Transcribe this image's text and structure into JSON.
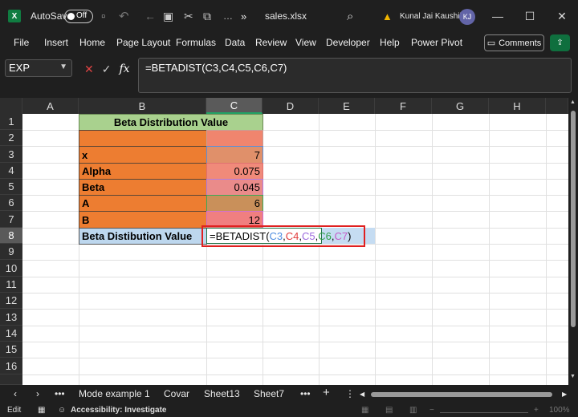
{
  "titlebar": {
    "autosave_label": "AutoSave",
    "autosave_state": "Off",
    "filename": "sales.xlsx",
    "more": "»",
    "user_name": "Kunal Jai Kaushik",
    "user_initials": "KJ"
  },
  "menu": [
    "File",
    "Insert",
    "Home",
    "Page Layout",
    "Formulas",
    "Data",
    "Review",
    "View",
    "Developer",
    "Help",
    "Power Pivot"
  ],
  "comments_label": "Comments",
  "formula_bar": {
    "name_box": "EXP",
    "fx": "fx",
    "formula": "=BETADIST(C3,C4,C5,C6,C7)"
  },
  "columns": [
    "A",
    "B",
    "C",
    "D",
    "E",
    "F",
    "G",
    "H"
  ],
  "rows": [
    "1",
    "2",
    "3",
    "4",
    "5",
    "6",
    "7",
    "8",
    "9",
    "10",
    "11",
    "12",
    "13",
    "14",
    "15",
    "16"
  ],
  "sheet": {
    "header": "Beta Distribution Value",
    "labels": [
      "x",
      "Alpha",
      "Beta",
      "A",
      "B"
    ],
    "values": [
      "7",
      "0.075",
      "0.045",
      "6",
      "12"
    ],
    "result_label": "Beta Distibution Value",
    "edit_parts": {
      "pre": "=BETADIST(",
      "a1": "C3",
      "s1": ",",
      "a2": "C4",
      "s2": ",",
      "a3": "C5",
      "s3": ",",
      "a4": "C6",
      "s4": ",",
      "a5": "C7",
      "post": ")"
    },
    "ref_colors": [
      "#4e8de0",
      "#e03b3b",
      "#9c6ade",
      "#2e9e46",
      "#c659c6"
    ]
  },
  "tabs": [
    "Mode example 1",
    "Covar",
    "Sheet13",
    "Sheet7"
  ],
  "status": {
    "mode": "Edit",
    "accessibility": "Accessibility: Investigate",
    "zoom": "100%"
  }
}
